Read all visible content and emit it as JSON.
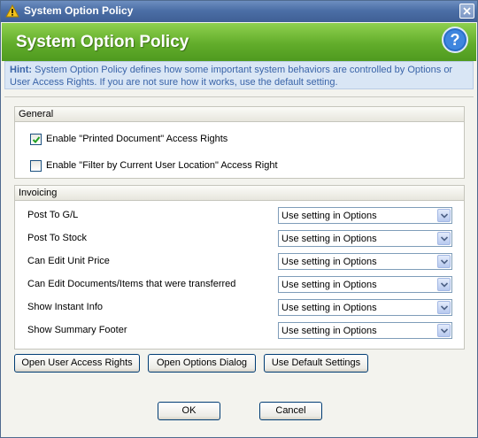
{
  "window": {
    "title": "System Option Policy"
  },
  "banner": {
    "title": "System Option Policy"
  },
  "hint": {
    "label": "Hint:",
    "text": " System Option Policy defines how some important system behaviors are controlled by Options or User Access Rights. If you are not sure how it works, use the default setting."
  },
  "general": {
    "header": "General",
    "options": [
      {
        "label": "Enable \"Printed Document\" Access Rights",
        "checked": true
      },
      {
        "label": "Enable \"Filter by Current User Location\" Access Right",
        "checked": false
      }
    ]
  },
  "invoicing": {
    "header": "Invoicing",
    "rows": [
      {
        "label": "Post To G/L",
        "value": "Use setting in Options"
      },
      {
        "label": "Post To Stock",
        "value": "Use setting in Options"
      },
      {
        "label": "Can Edit Unit Price",
        "value": "Use setting in Options"
      },
      {
        "label": "Can Edit Documents/Items that were transferred",
        "value": "Use setting in Options"
      },
      {
        "label": "Show Instant Info",
        "value": "Use setting in Options"
      },
      {
        "label": "Show Summary Footer",
        "value": "Use setting in Options"
      }
    ]
  },
  "actions": {
    "open_user_access_rights": "Open User Access Rights",
    "open_options_dialog": "Open Options Dialog",
    "use_default_settings": "Use Default Settings"
  },
  "dialog_buttons": {
    "ok": "OK",
    "cancel": "Cancel"
  },
  "colors": {
    "banner_green": "#62ad2b",
    "title_blue": "#4c6fa6",
    "hint_text": "#3a64a8",
    "hint_bg": "#d9e6f5"
  }
}
